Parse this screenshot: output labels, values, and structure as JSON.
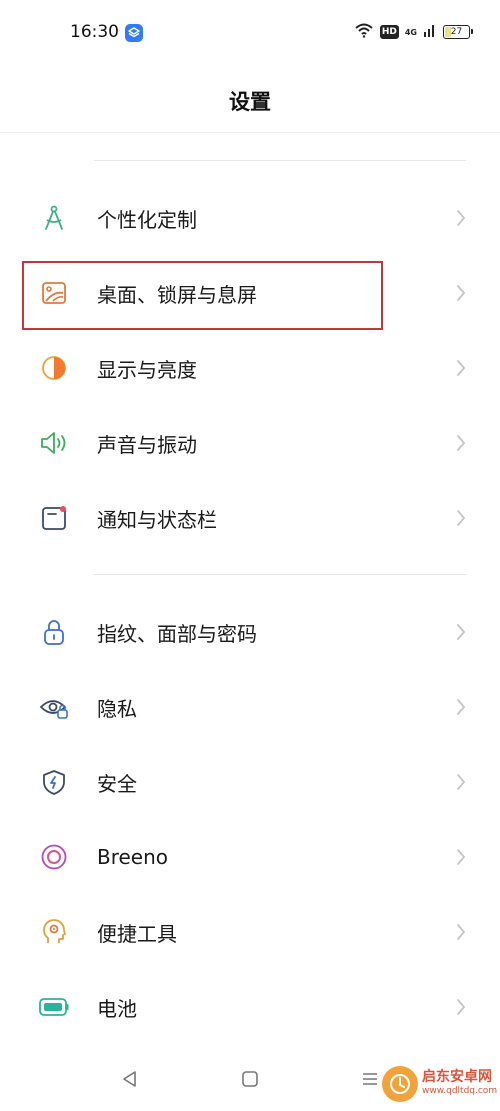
{
  "status_bar": {
    "time": "16:30",
    "hd": "HD",
    "network": "4G",
    "battery": "27",
    "battery_level_percent": 27
  },
  "page": {
    "title": "设置"
  },
  "menu_items": [
    {
      "label": "个性化定制",
      "icon": "compass-icon",
      "color": "#3fae8a"
    },
    {
      "label": "桌面、锁屏与息屏",
      "icon": "wallpaper-icon",
      "color": "#e07a3a"
    },
    {
      "label": "显示与亮度",
      "icon": "brightness-icon",
      "color": "#f0a030"
    },
    {
      "label": "声音与振动",
      "icon": "speaker-icon",
      "color": "#3aae5a"
    },
    {
      "label": "通知与状态栏",
      "icon": "notification-icon",
      "color": "#3b4a66"
    },
    {
      "label": "指纹、面部与密码",
      "icon": "lock-icon",
      "color": "#3a6fd0"
    },
    {
      "label": "隐私",
      "icon": "privacy-eye-icon",
      "color": "#3a6fd0"
    },
    {
      "label": "安全",
      "icon": "shield-icon",
      "color": "#3a6fd0"
    },
    {
      "label": "Breeno",
      "icon": "breeno-icon",
      "color": "#b04ac0"
    },
    {
      "label": "便捷工具",
      "icon": "tools-head-icon",
      "color": "#e0a040"
    },
    {
      "label": "电池",
      "icon": "battery-icon",
      "color": "#2ab39a"
    }
  ],
  "watermark": {
    "title": "启东安卓网",
    "url": "www.qdltdq.com"
  }
}
